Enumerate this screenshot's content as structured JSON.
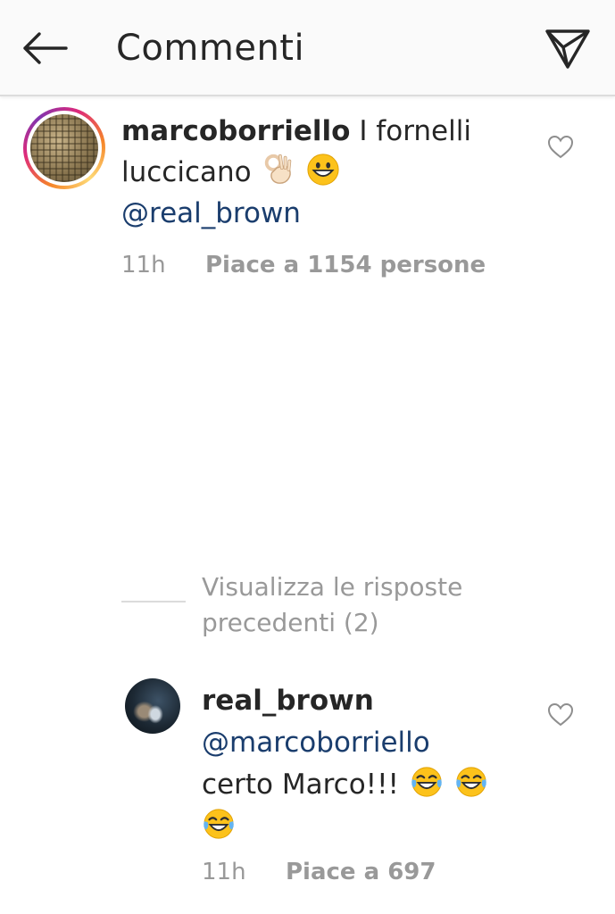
{
  "header": {
    "title": "Commenti",
    "back_icon": "arrow-left-icon",
    "send_icon": "send-paper-plane-icon"
  },
  "comments": [
    {
      "username": "marcoborriello",
      "text": "I fornelli luccicano",
      "emojis": [
        "ok-hand",
        "grinning-sweat"
      ],
      "mention": "@real_brown",
      "time": "11h",
      "likes": "Piace a 1154 persone"
    },
    {
      "username": "real_brown",
      "mention": "@marcoborriello",
      "text": "certo Marco!!!",
      "emojis": [
        "tears-of-joy",
        "tears-of-joy",
        "tears-of-joy"
      ],
      "time": "11h",
      "likes": "Piace a 697"
    }
  ],
  "replies_toggle": "Visualizza le risposte precedenti (2)",
  "colors": {
    "mention": "#1a3d6d",
    "meta": "#999999",
    "header_bg": "#fafafa"
  }
}
